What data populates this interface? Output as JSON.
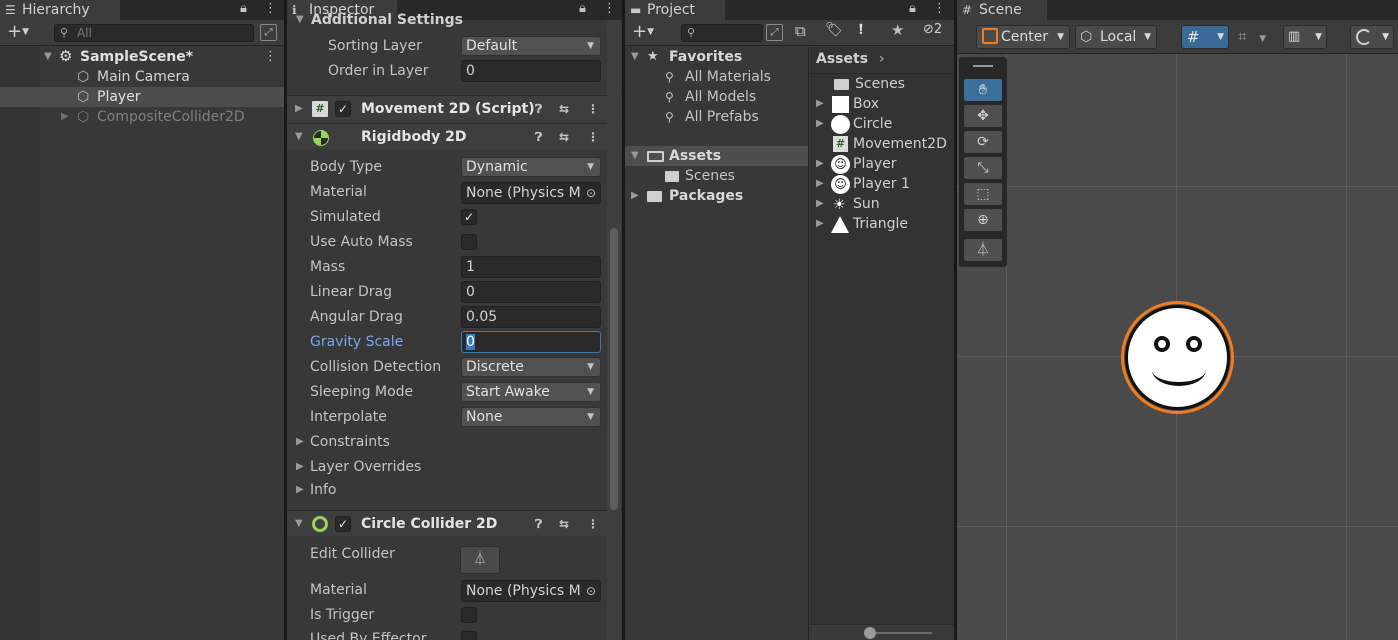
{
  "hierarchy": {
    "tab_title": "Hierarchy",
    "search_placeholder": "All",
    "scene_name": "SampleScene*",
    "items": [
      {
        "label": "Main Camera"
      },
      {
        "label": "Player"
      },
      {
        "label": "CompositeCollider2D"
      }
    ]
  },
  "inspector": {
    "tab_title": "Inspector",
    "section_header": "Additional Settings",
    "sorting_layer_label": "Sorting Layer",
    "sorting_layer_value": "Default",
    "order_label": "Order in Layer",
    "order_value": "0",
    "movement": {
      "title": "Movement 2D (Script)",
      "icon": "#"
    },
    "rigidbody": {
      "title": "Rigidbody 2D",
      "body_type_label": "Body Type",
      "body_type_value": "Dynamic",
      "material_label": "Material",
      "material_value": "None (Physics M",
      "simulated_label": "Simulated",
      "auto_mass_label": "Use Auto Mass",
      "mass_label": "Mass",
      "mass_value": "1",
      "linear_drag_label": "Linear Drag",
      "linear_drag_value": "0",
      "angular_drag_label": "Angular Drag",
      "angular_drag_value": "0.05",
      "gravity_label": "Gravity Scale",
      "gravity_value": "0",
      "collision_label": "Collision Detection",
      "collision_value": "Discrete",
      "sleeping_label": "Sleeping Mode",
      "sleeping_value": "Start Awake",
      "interpolate_label": "Interpolate",
      "interpolate_value": "None",
      "constraints_label": "Constraints",
      "overrides_label": "Layer Overrides",
      "info_label": "Info"
    },
    "circle_collider": {
      "title": "Circle Collider 2D",
      "edit_label": "Edit Collider",
      "material_label": "Material",
      "material_value": "None (Physics M",
      "trigger_label": "Is Trigger",
      "effector_label": "Used By Effector"
    }
  },
  "project": {
    "tab_title": "Project",
    "favorites_label": "Favorites",
    "favorites": [
      "All Materials",
      "All Models",
      "All Prefabs"
    ],
    "assets_label": "Assets",
    "assets_children": [
      "Scenes"
    ],
    "packages_label": "Packages",
    "breadcrumb": "Assets",
    "hidden_count": "2",
    "asset_items": [
      "Scenes",
      "Box",
      "Circle",
      "Movement2D",
      "Player",
      "Player 1",
      "Sun",
      "Triangle"
    ]
  },
  "scene": {
    "tab_title": "Scene",
    "pivot_label": "Center",
    "space_label": "Local"
  },
  "colors": {
    "accent_blue": "#2c5d87",
    "highlight_label": "#7aa8e8",
    "collider_orange": "#f07d1e",
    "scene_bg": "#4a4a4a"
  }
}
